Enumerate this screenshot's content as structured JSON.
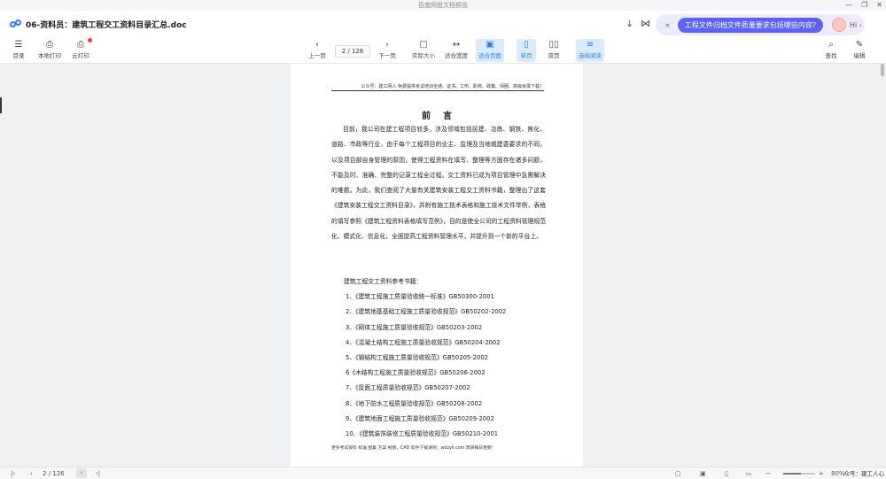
{
  "window": {
    "title": "百度网盘文档预览",
    "controls": [
      "—",
      "❐",
      "✕"
    ]
  },
  "header": {
    "doc_title": "06-资料员：建筑工程交工资料目录汇总.doc",
    "download_icon": "⤓",
    "share_icon": "⋈",
    "ai_close": "×",
    "ai_question": "工程文件归档文件质量要求包括哪些内容?",
    "ai_hi": "Hi ›"
  },
  "toolbar": {
    "left": [
      {
        "icon": "☰",
        "label": "目录"
      },
      {
        "icon": "⎙",
        "label": "本地打印"
      },
      {
        "icon": "⎙",
        "label": "云打印"
      }
    ],
    "prev": {
      "icon": "‹",
      "label": "上一页"
    },
    "page_indicator": "2 / 126",
    "next": {
      "icon": "›",
      "label": "下一页"
    },
    "views": [
      {
        "icon": "▢",
        "label": "实际大小"
      },
      {
        "icon": "↔",
        "label": "适合宽度"
      },
      {
        "icon": "▣",
        "label": "适合页面"
      },
      {
        "icon": "▯",
        "label": "单页"
      },
      {
        "icon": "▯▯",
        "label": "双页"
      },
      {
        "icon": "≡",
        "label": "连续阅读"
      }
    ],
    "search": {
      "icon": "⌕",
      "label": "查找"
    },
    "edit": {
      "icon": "✎",
      "label": "编辑"
    }
  },
  "page": {
    "header_text": "公众号：建工网人  免费提供考试培训全通、证书、工伤、职称、政策、师圈、高级目录下载！",
    "title": "前言",
    "paragraph": "目前，我公司在建工程项目较多，涉及领域包括民建、冶炼、钢铁、焦化、道路、市政等行业，由于每个工程项目的业主、监理及当地城建委要求的不同，以及项目部自身管理的原因，使得工程资料在填写、整理等方面存在诸多问题，不能及时、准确、完整的记录工程全过程。交工资料已成为项目管理中急需解决的难题。为此，我们查阅了大量有关建筑安装工程交工资料书籍，整理出了这套《建筑安装工程交工资料目录》，并附有施工技术表格和施工技术文件举例，表格的填写参照《建筑工程资料表格填写范例》，目的是使全公司的工程资料管理规范化、模式化、信息化，全面提高工程资料管理水平，并提升到一个新的平台上。",
    "refs_intro": "建筑工程交工资料参考书籍：",
    "refs": [
      "1、《建筑工程施工质量验收统一标准》GB50300-2001",
      "2、《建筑地基基础工程施工质量验收规范》GB50202-2002",
      "3、《砌体工程施工质量验收规范》GB50203-2002",
      "4、《混凝土结构工程施工质量验收规范》GB50204-2002",
      "5、《钢结构工程施工质量验收规范》GB50205-2002",
      "6《木结构工程施工质量验收规范》GB50206-2002",
      "7、《屋面工程质量验收规范》GB50207-2002",
      "8、《地下防水工程质量验收规范》GB50208-2002",
      "9、《建筑地面工程施工质量验收规范》GB50209-2002",
      "10、《建筑装饰装修工程质量验收规范》GB50210-2001"
    ],
    "footer_text": "更多考试资料 标准 图集 方案 视频，CAD 软件下载请到：wdzyk.com 筑研每日更新！"
  },
  "bottombar": {
    "first": "|‹",
    "prev": "‹",
    "page_indicator": "2 / 126",
    "next": "›",
    "last": "›|",
    "zoom_percent": "80%",
    "zoom_fraction": 0.55,
    "watermark": "众号：建工人心"
  }
}
